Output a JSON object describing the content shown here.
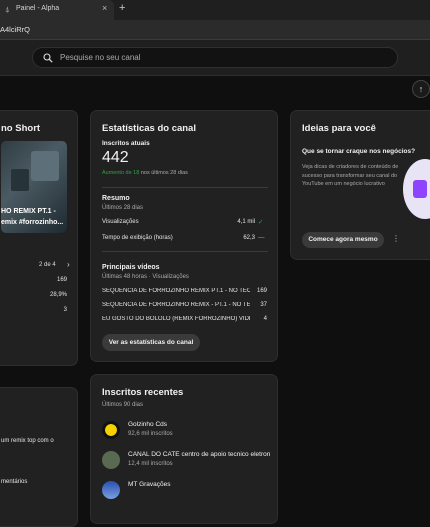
{
  "browser": {
    "tab_title": "Painel - Alpha",
    "tab_close": "×",
    "new_tab": "+",
    "address_fragment": "A4lciRrQ"
  },
  "header": {
    "search_placeholder": "Pesquise no seu canal",
    "upload_icon": "↑"
  },
  "short_card": {
    "title_fragment": "no Short",
    "thumb_caption_line1": "HO REMIX PT.1 -",
    "thumb_caption_line2": "emix #forrozinho...",
    "pager": "2 de 4",
    "stats": [
      "169",
      "28,9%",
      "3"
    ]
  },
  "left_bottom_card": {
    "text1": "um remix top com o",
    "text2": "mentários"
  },
  "stats_card": {
    "title": "Estatísticas do canal",
    "subs_label": "Inscritos atuais",
    "subs_value": "442",
    "subs_delta_green": "Aumento de 18",
    "subs_delta_rest": " nos últimos 28 dias",
    "summary_title": "Resumo",
    "summary_period": "Últimos 28 dias",
    "rows": [
      {
        "label": "Visualizações",
        "value": "4,1 mil",
        "trend": "✓"
      },
      {
        "label": "Tempo de exibição (horas)",
        "value": "62,3",
        "trend": "—"
      }
    ],
    "videos_title": "Principais vídeos",
    "videos_period": "Últimas 48 horas · Visualizações",
    "videos": [
      {
        "title": "SEQUÊNCIA DE FORROZINHO REMIX PT.1 - NO TECL...",
        "views": "169"
      },
      {
        "title": "SEQUÊNCIA DE FORROZINHO REMIX - PT.1 - NO TEC...",
        "views": "37"
      },
      {
        "title": "EU GOSTO DO BOLOLO (REMIX FORROZINHO) VÍDE...",
        "views": "4"
      }
    ],
    "cta": "Ver as estatísticas do canal"
  },
  "ideas_card": {
    "title": "Ideias para você",
    "headline": "Que se tornar craque nos negócios?",
    "body": "Veja dicas de criadores de conteúdo de sucesso para transformar seu canal do YouTube em um negócio lucrativo",
    "cta": "Comece agora mesmo",
    "more": "⋮"
  },
  "recent_subs_card": {
    "title": "Inscritos recentes",
    "period": "Últimos 90 dias",
    "items": [
      {
        "name": "Golzinho Cds",
        "subs": "92,6 mil inscritos"
      },
      {
        "name": "CANAL DO CATE centro de apoio tecnico eletron...",
        "subs": "12,4 mil inscritos"
      },
      {
        "name": "MT Gravações",
        "subs": ""
      }
    ]
  },
  "colors": {
    "background": "#0f0f0f",
    "card": "#212121",
    "green": "#2ba640",
    "accent_logo": "#8e44ff"
  }
}
